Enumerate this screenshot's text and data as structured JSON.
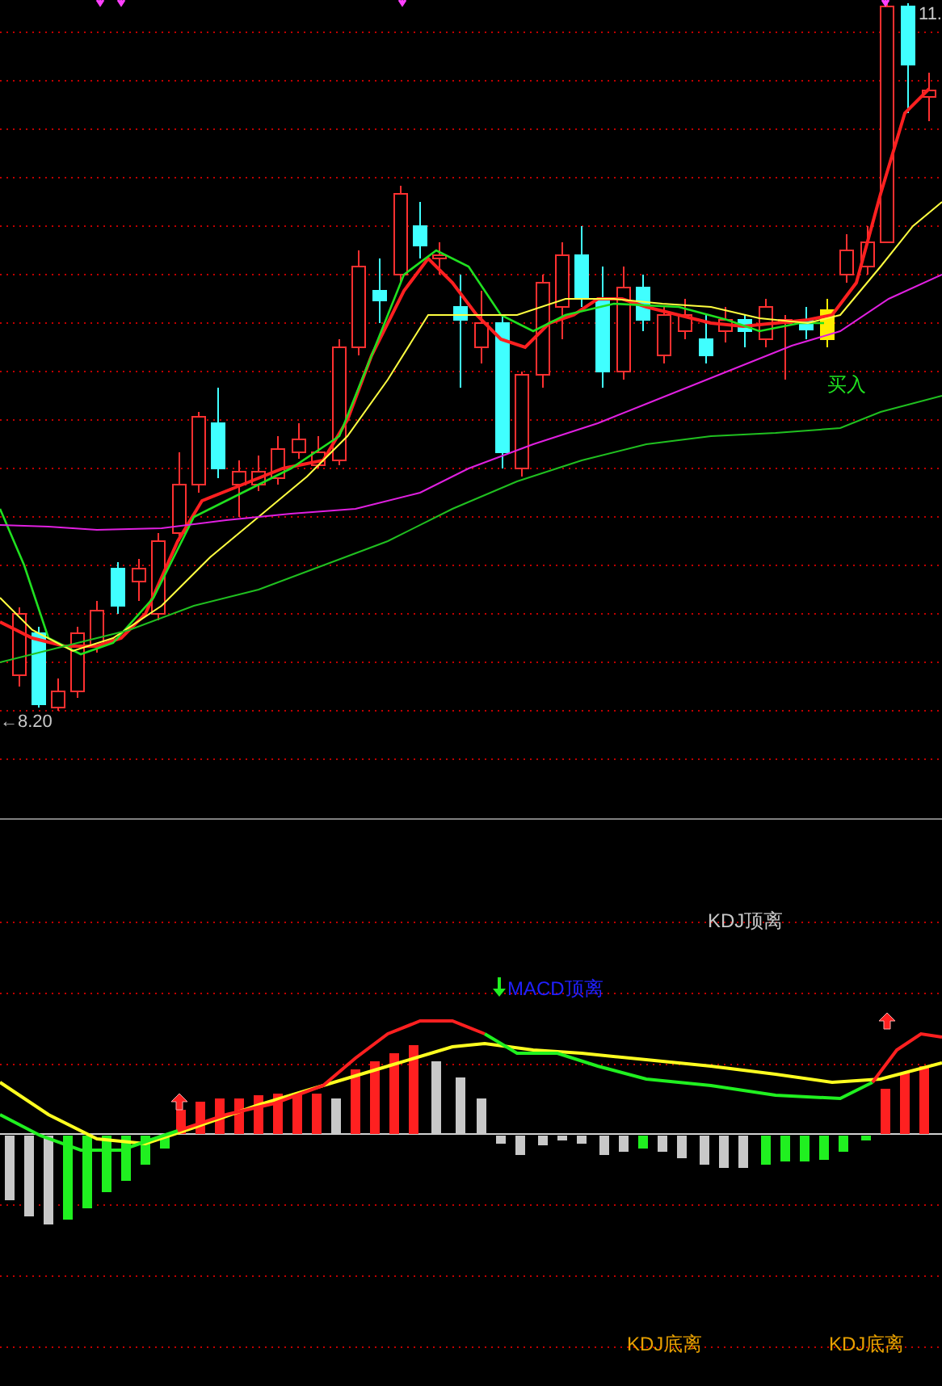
{
  "price_panel": {
    "high_label": "11.",
    "low_label": "←8.20",
    "buy_signal": "买入"
  },
  "indicator_panel": {
    "signals": [
      {
        "text": "KDJ顶离",
        "kind": "kdj_top"
      },
      {
        "text": "MACD顶离",
        "kind": "macd_top"
      },
      {
        "text": "KDJ底离",
        "kind": "kdj_bottom"
      },
      {
        "text": "KDJ底离",
        "kind": "kdj_bottom"
      }
    ]
  }
}
